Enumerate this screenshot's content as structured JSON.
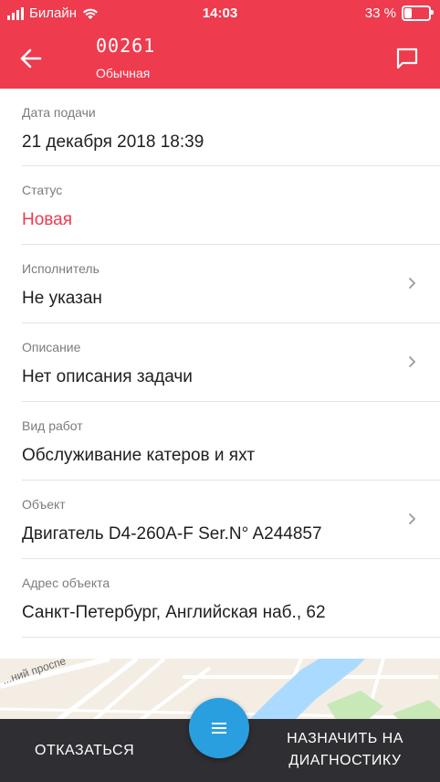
{
  "status_bar": {
    "carrier": "Билайн",
    "time": "14:03",
    "battery_text": "33 %",
    "battery_level": 0.33
  },
  "header": {
    "ticket_id": "00261",
    "priority": "Обычная"
  },
  "fields": [
    {
      "label": "Дата подачи",
      "value": "21 декабря 2018 18:39"
    },
    {
      "label": "Статус",
      "value": "Новая"
    },
    {
      "label": "Исполнитель",
      "value": "Не указан"
    },
    {
      "label": "Описание",
      "value": "Нет описания задачи"
    },
    {
      "label": "Вид работ",
      "value": "Обслуживание катеров и яхт"
    },
    {
      "label": "Объект",
      "value": "Двигатель D4-260A-F Ser.N° A244857"
    },
    {
      "label": "Адрес объекта",
      "value": "Санкт-Петербург, Английская наб., 62"
    }
  ],
  "map": {
    "street_label": "...ний проспе"
  },
  "actions": {
    "decline": "ОТКАЗАТЬСЯ",
    "assign_line1": "НАЗНАЧИТЬ НА",
    "assign_line2": "ДИАГНОСТИКУ"
  },
  "colors": {
    "accent": "#ee3b4e",
    "fab": "#2a9fe0",
    "bottom_bar": "#2f2f33"
  }
}
